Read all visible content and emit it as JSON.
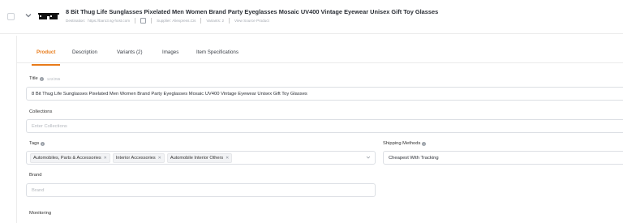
{
  "product": {
    "title": "8 Bit Thug Life Sunglasses Pixelated Men Women Brand Party Eyeglasses Mosaic UV400 Vintage Eyewear Unisex Gift Toy Glasses",
    "meta": {
      "destination": "Destination: ",
      "destination_value": "https://baro3.sg-host.com",
      "supplier": "Supplier: Aliexpress.Cis",
      "variants": "Variants: 2",
      "view_source": "View Source Product"
    }
  },
  "tabs": [
    {
      "label": "Product",
      "active": true
    },
    {
      "label": "Description",
      "active": false
    },
    {
      "label": "Variants (2)",
      "active": false
    },
    {
      "label": "Images",
      "active": false
    },
    {
      "label": "Item Specifications",
      "active": false
    }
  ],
  "form": {
    "title_label": "Title",
    "title_count": "122/255",
    "title_value": "8 Bit Thug Life Sunglasses Pixelated Men Women Brand Party Eyeglasses Mosaic UV400 Vintage Eyewear Unisex Gift Toy Glasses",
    "collections_label": "Collections",
    "collections_placeholder": "Enter Collections",
    "tags_label": "Tags",
    "tags": [
      "Automobiles, Parts & Accessories",
      "Interior Accessories",
      "Automobile Interior Others"
    ],
    "shipping_label": "Shipping Methods",
    "shipping_value": "Cheapest With Tracking",
    "brand_label": "Brand",
    "brand_placeholder": "Brand",
    "monitoring_label": "Monitoring"
  },
  "colors": {
    "accent": "#e87b1a",
    "border": "#dcdfe4"
  },
  "icons": [
    "chevron-down-icon",
    "sunglasses-thumbnail",
    "note-icon",
    "info-icon",
    "remove-tag-icon",
    "dropdown-arrow-icon"
  ]
}
